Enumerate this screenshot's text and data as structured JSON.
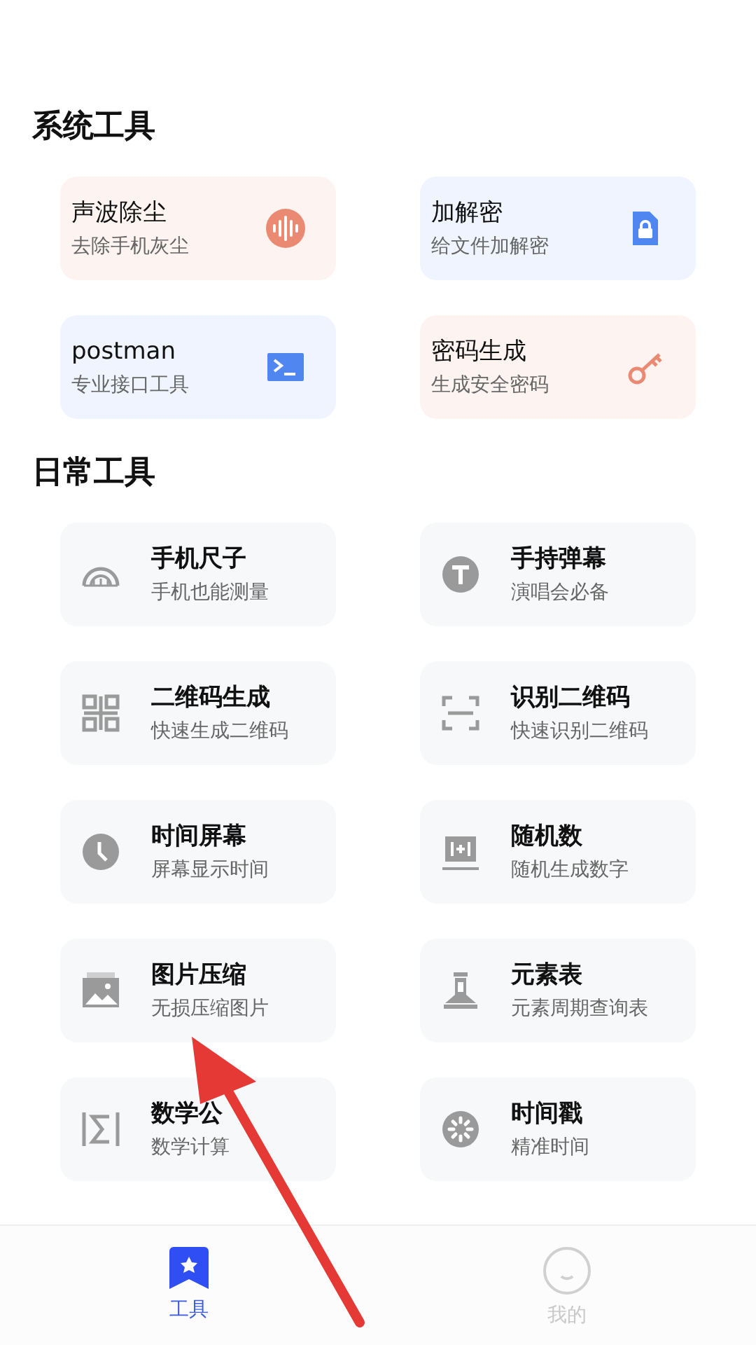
{
  "sections": [
    {
      "title": "系统工具",
      "kind": "system",
      "items": [
        {
          "title": "声波除尘",
          "subtitle": "去除手机灰尘",
          "color": "#ea8a73"
        },
        {
          "title": "加解密",
          "subtitle": "给文件加解密",
          "color": "#4f86f0"
        },
        {
          "title": "postman",
          "subtitle": "专业接口工具",
          "color": "#4f86f0"
        },
        {
          "title": "密码生成",
          "subtitle": "生成安全密码",
          "color": "#ea8a73"
        }
      ]
    },
    {
      "title": "日常工具",
      "kind": "daily",
      "items": [
        {
          "title": "手机尺子",
          "subtitle": "手机也能测量"
        },
        {
          "title": "手持弹幕",
          "subtitle": "演唱会必备"
        },
        {
          "title": "二维码生成",
          "subtitle": "快速生成二维码"
        },
        {
          "title": "识别二维码",
          "subtitle": "快速识别二维码"
        },
        {
          "title": "时间屏幕",
          "subtitle": "屏幕显示时间"
        },
        {
          "title": "随机数",
          "subtitle": "随机生成数字"
        },
        {
          "title": "图片压缩",
          "subtitle": "无损压缩图片"
        },
        {
          "title": "元素表",
          "subtitle": "元素周期查询表"
        },
        {
          "title": "数学公",
          "subtitle": "数学计算"
        },
        {
          "title": "时间戳",
          "subtitle": "精准时间"
        }
      ]
    }
  ],
  "tab_bar": [
    {
      "label": "工具",
      "selected": true
    },
    {
      "label": "我的",
      "selected": false
    }
  ]
}
